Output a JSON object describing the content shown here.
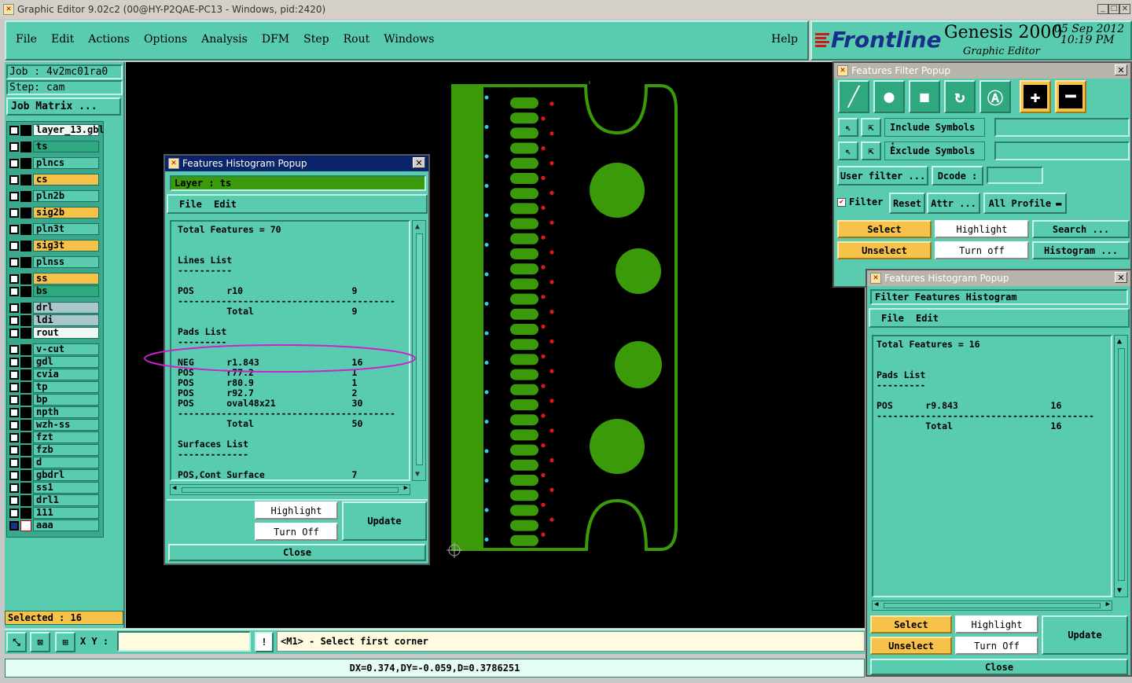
{
  "window": {
    "title": "Graphic Editor 9.02c2 (00@HY-P2QAE-PC13 - Windows, pid:2420)"
  },
  "menubar": {
    "items": [
      "File",
      "Edit",
      "Actions",
      "Options",
      "Analysis",
      "DFM",
      "Step",
      "Rout",
      "Windows"
    ],
    "help": "Help"
  },
  "brand": {
    "logo": "Frontline",
    "product": "Genesis 2000",
    "subtitle": "Graphic Editor",
    "date": "05 Sep 2012",
    "time": "10:19 PM"
  },
  "job": {
    "job": "Job : 4v2mc01ra0",
    "step": "Step: cam",
    "matrix_button": "Job Matrix ..."
  },
  "layers": [
    {
      "name": "layer_13.gbl",
      "style": "white"
    },
    {
      "name": "ts",
      "style": "green"
    },
    {
      "name": "plncs",
      "style": "teal"
    },
    {
      "name": "cs",
      "style": "orange"
    },
    {
      "name": "pln2b",
      "style": "teal"
    },
    {
      "name": "sig2b",
      "style": "orange"
    },
    {
      "name": "pln3t",
      "style": "teal"
    },
    {
      "name": "sig3t",
      "style": "orange"
    },
    {
      "name": "plnss",
      "style": "teal"
    },
    {
      "name": "ss",
      "style": "orange"
    },
    {
      "name": "bs",
      "style": "green"
    },
    {
      "name": "drl",
      "style": "gray"
    },
    {
      "name": "ldi",
      "style": "gray"
    },
    {
      "name": "rout",
      "style": "white"
    },
    {
      "name": "v-cut",
      "style": "teal"
    },
    {
      "name": "gdl",
      "style": "teal"
    },
    {
      "name": "cvia",
      "style": "teal"
    },
    {
      "name": "tp",
      "style": "teal"
    },
    {
      "name": "bp",
      "style": "teal"
    },
    {
      "name": "npth",
      "style": "teal"
    },
    {
      "name": "wzh-ss",
      "style": "teal"
    },
    {
      "name": "fzt",
      "style": "teal"
    },
    {
      "name": "fzb",
      "style": "teal"
    },
    {
      "name": "d",
      "style": "teal"
    },
    {
      "name": "gbdrl",
      "style": "teal"
    },
    {
      "name": "ss1",
      "style": "teal"
    },
    {
      "name": "drl1",
      "style": "teal"
    },
    {
      "name": "111",
      "style": "teal"
    },
    {
      "name": "aaa",
      "style": "teal"
    }
  ],
  "selected": "Selected : 16",
  "statusbar": {
    "xy_label": "X Y :",
    "xy_value": "",
    "prompt": "<M1> - Select first corner",
    "measure": "DX=0.374,DY=-0.059,D=0.3786251"
  },
  "histogram1": {
    "title": "Features Histogram Popup",
    "layer": "Layer :  ts",
    "menu": [
      "File",
      "Edit"
    ],
    "lines": [
      "Total Features = 70",
      "",
      "",
      "Lines List",
      "----------",
      "",
      "POS      r10                    9",
      "----------------------------------------",
      "         Total                  9",
      "",
      "Pads List",
      "---------",
      "",
      "NEG      r1.843                 16",
      "POS      r77.2                  1",
      "POS      r80.9                  1",
      "POS      r92.7                  2",
      "POS      oval48x21              30",
      "----------------------------------------",
      "         Total                  50",
      "",
      "Surfaces List",
      "-------------",
      "",
      "POS,Cont Surface                7"
    ],
    "highlight": "Highlight",
    "turn_off": "Turn Off",
    "update": "Update",
    "close": "Close"
  },
  "filter": {
    "title": "Features Filter Popup",
    "include": "Include Symbols :",
    "exclude": "Exclude Symbols :",
    "user_filter": "User filter ...",
    "dcode": "Dcode :",
    "filter": "Filter",
    "reset": "Reset",
    "attr": "Attr ...",
    "profile": "All Profile",
    "select": "Select",
    "highlight": "Highlight",
    "search": "Search ...",
    "unselect": "Unselect",
    "turn_off": "Turn off",
    "histogram": "Histogram ..."
  },
  "histogram2": {
    "title": "Features Histogram Popup",
    "header": "Filter Features Histogram",
    "menu": [
      "File",
      "Edit"
    ],
    "lines": [
      "Total Features = 16",
      "",
      "",
      "Pads List",
      "---------",
      "",
      "POS      r9.843                 16",
      "----------------------------------------",
      "         Total                  16"
    ],
    "select": "Select",
    "highlight": "Highlight",
    "update": "Update",
    "unselect": "Unselect",
    "turn_off": "Turn Off",
    "close": "Close"
  },
  "colors": {
    "copper": "#3a9a0a",
    "canvas": "#000000",
    "panel": "#59ccb0",
    "accent_orange": "#f7c24a"
  }
}
